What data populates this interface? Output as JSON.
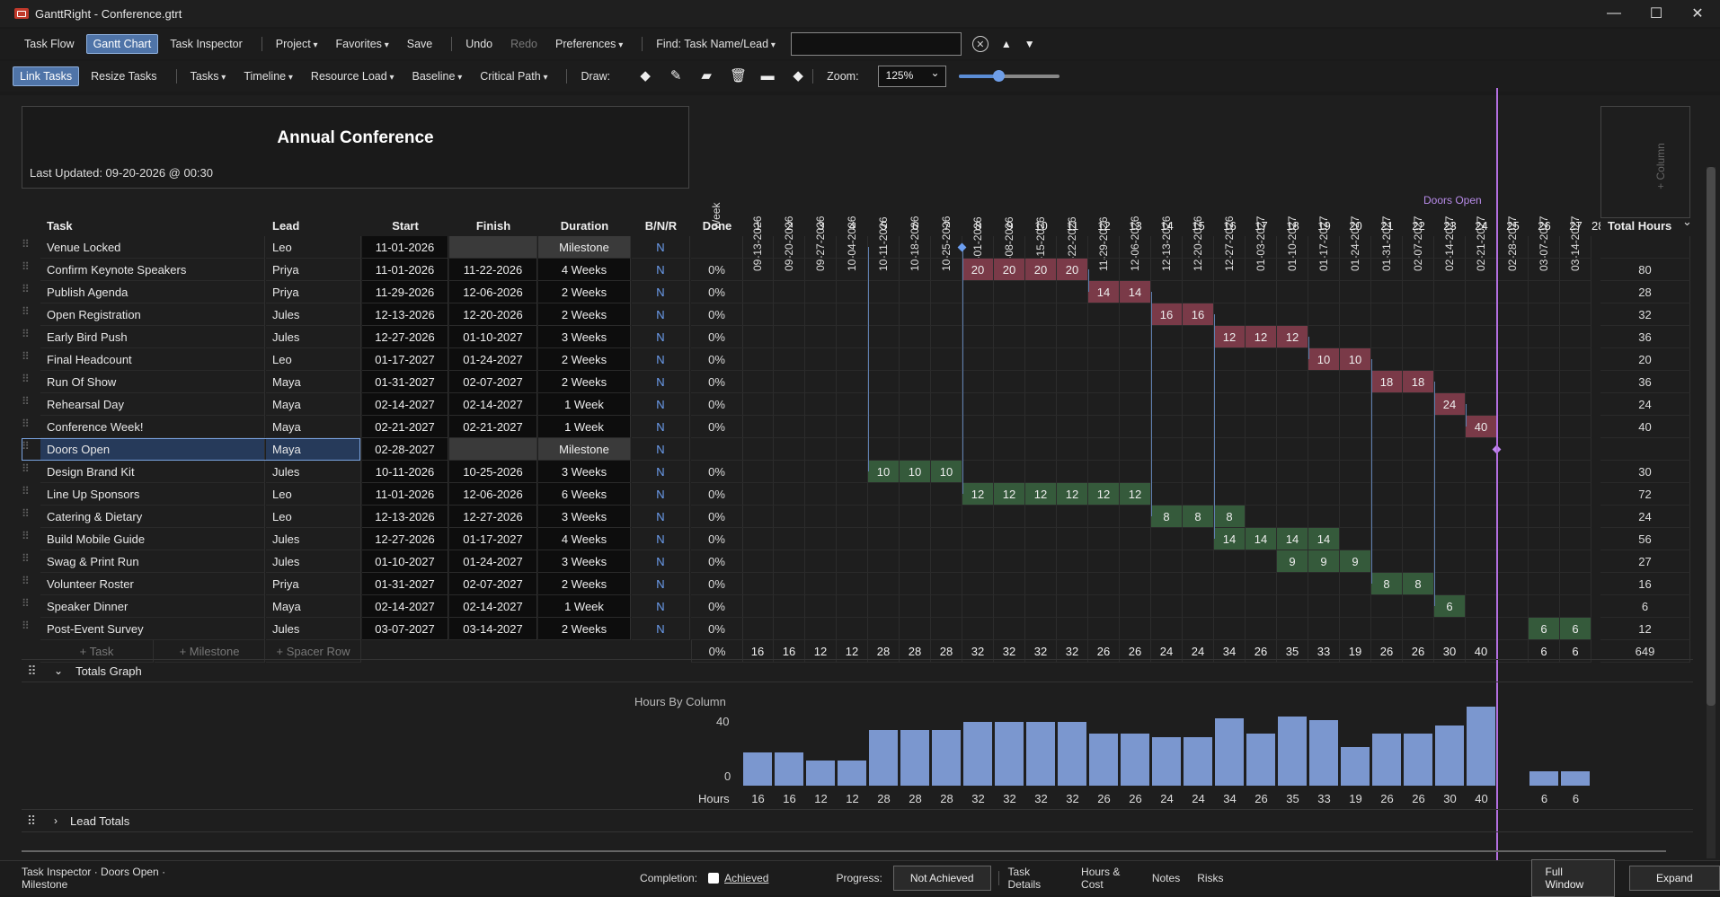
{
  "window": {
    "title": "GanttRight - Conference.gtrt",
    "minimize": "—",
    "maximize": "☐",
    "close": "✕"
  },
  "toolbar1": {
    "task_flow": "Task Flow",
    "gantt_chart": "Gantt Chart",
    "task_inspector": "Task Inspector",
    "project": "Project",
    "favorites": "Favorites",
    "save": "Save",
    "undo": "Undo",
    "redo": "Redo",
    "preferences": "Preferences",
    "find_label": "Find: Task Name/Lead",
    "find_value": ""
  },
  "toolbar2": {
    "link_tasks": "Link Tasks",
    "resize_tasks": "Resize Tasks",
    "tasks": "Tasks",
    "timeline": "Timeline",
    "resource_load": "Resource Load",
    "baseline": "Baseline",
    "critical_path": "Critical Path",
    "draw_label": "Draw:",
    "zoom_label": "Zoom:",
    "zoom_value": "125%",
    "zoom_slider": 0.4
  },
  "project": {
    "title": "Annual Conference",
    "last_updated": "Last Updated: 09-20-2026 @ 00:30"
  },
  "timeline": {
    "week_label": "Week",
    "dates": [
      "09-13-2026",
      "09-20-2026",
      "09-27-2026",
      "10-04-2026",
      "10-11-2026",
      "10-18-2026",
      "10-25-2026",
      "11-01-2026",
      "11-08-2026",
      "11-15-2026",
      "11-22-2026",
      "11-29-2026",
      "12-06-2026",
      "12-13-2026",
      "12-20-2026",
      "12-27-2026",
      "01-03-2027",
      "01-10-2027",
      "01-17-2027",
      "01-24-2027",
      "01-31-2027",
      "02-07-2027",
      "02-14-2027",
      "02-21-2027",
      "02-28-2027",
      "03-07-2027",
      "03-14-2027"
    ],
    "weeks": [
      "1",
      "2",
      "3",
      "4",
      "5",
      "6",
      "7",
      "8",
      "9",
      "10",
      "11",
      "12",
      "13",
      "14",
      "15",
      "16",
      "17",
      "18",
      "19",
      "20",
      "21",
      "22",
      "23",
      "24",
      "25",
      "26",
      "27",
      "28"
    ],
    "add_column": "+ Column",
    "doors_open_marker": "Doors Open"
  },
  "columns": {
    "task": "Task",
    "lead": "Lead",
    "start": "Start",
    "finish": "Finish",
    "duration": "Duration",
    "bnr": "B/N/R",
    "done": "Done",
    "total": "Total Hours"
  },
  "tasks": [
    {
      "name": "Venue Locked",
      "lead": "Leo",
      "start": "11-01-2026",
      "finish": "",
      "duration": "Milestone",
      "bnr": "N",
      "done": "",
      "total": "",
      "color": "ms",
      "weeks": {}
    },
    {
      "name": "Confirm Keynote Speakers",
      "lead": "Priya",
      "start": "11-01-2026",
      "finish": "11-22-2026",
      "duration": "4 Weeks",
      "bnr": "N",
      "done": "0%",
      "total": "80",
      "color": "red",
      "weeks": {
        "8": "20",
        "9": "20",
        "10": "20",
        "11": "20"
      }
    },
    {
      "name": "Publish Agenda",
      "lead": "Priya",
      "start": "11-29-2026",
      "finish": "12-06-2026",
      "duration": "2 Weeks",
      "bnr": "N",
      "done": "0%",
      "total": "28",
      "color": "red",
      "weeks": {
        "12": "14",
        "13": "14"
      }
    },
    {
      "name": "Open Registration",
      "lead": "Jules",
      "start": "12-13-2026",
      "finish": "12-20-2026",
      "duration": "2 Weeks",
      "bnr": "N",
      "done": "0%",
      "total": "32",
      "color": "red",
      "weeks": {
        "14": "16",
        "15": "16"
      }
    },
    {
      "name": "Early Bird Push",
      "lead": "Jules",
      "start": "12-27-2026",
      "finish": "01-10-2027",
      "duration": "3 Weeks",
      "bnr": "N",
      "done": "0%",
      "total": "36",
      "color": "red",
      "weeks": {
        "16": "12",
        "17": "12",
        "18": "12"
      }
    },
    {
      "name": "Final Headcount",
      "lead": "Leo",
      "start": "01-17-2027",
      "finish": "01-24-2027",
      "duration": "2 Weeks",
      "bnr": "N",
      "done": "0%",
      "total": "20",
      "color": "red",
      "weeks": {
        "19": "10",
        "20": "10"
      }
    },
    {
      "name": "Run Of Show",
      "lead": "Maya",
      "start": "01-31-2027",
      "finish": "02-07-2027",
      "duration": "2 Weeks",
      "bnr": "N",
      "done": "0%",
      "total": "36",
      "color": "red",
      "weeks": {
        "21": "18",
        "22": "18"
      }
    },
    {
      "name": "Rehearsal Day",
      "lead": "Maya",
      "start": "02-14-2027",
      "finish": "02-14-2027",
      "duration": "1 Week",
      "bnr": "N",
      "done": "0%",
      "total": "24",
      "color": "red",
      "weeks": {
        "23": "24"
      }
    },
    {
      "name": "Conference Week!",
      "lead": "Maya",
      "start": "02-21-2027",
      "finish": "02-21-2027",
      "duration": "1 Week",
      "bnr": "N",
      "done": "0%",
      "total": "40",
      "color": "red",
      "weeks": {
        "24": "40"
      }
    },
    {
      "name": "Doors Open",
      "lead": "Maya",
      "start": "02-28-2027",
      "finish": "",
      "duration": "Milestone",
      "bnr": "N",
      "done": "",
      "total": "",
      "color": "ms",
      "weeks": {}
    },
    {
      "name": "Design Brand Kit",
      "lead": "Jules",
      "start": "10-11-2026",
      "finish": "10-25-2026",
      "duration": "3 Weeks",
      "bnr": "N",
      "done": "0%",
      "total": "30",
      "color": "grn",
      "weeks": {
        "5": "10",
        "6": "10",
        "7": "10"
      }
    },
    {
      "name": "Line Up Sponsors",
      "lead": "Leo",
      "start": "11-01-2026",
      "finish": "12-06-2026",
      "duration": "6 Weeks",
      "bnr": "N",
      "done": "0%",
      "total": "72",
      "color": "grn",
      "weeks": {
        "8": "12",
        "9": "12",
        "10": "12",
        "11": "12",
        "12": "12",
        "13": "12"
      }
    },
    {
      "name": "Catering & Dietary",
      "lead": "Leo",
      "start": "12-13-2026",
      "finish": "12-27-2026",
      "duration": "3 Weeks",
      "bnr": "N",
      "done": "0%",
      "total": "24",
      "color": "grn",
      "weeks": {
        "14": "8",
        "15": "8",
        "16": "8"
      }
    },
    {
      "name": "Build Mobile Guide",
      "lead": "Jules",
      "start": "12-27-2026",
      "finish": "01-17-2027",
      "duration": "4 Weeks",
      "bnr": "N",
      "done": "0%",
      "total": "56",
      "color": "grn",
      "weeks": {
        "16": "14",
        "17": "14",
        "18": "14",
        "19": "14"
      }
    },
    {
      "name": "Swag & Print Run",
      "lead": "Jules",
      "start": "01-10-2027",
      "finish": "01-24-2027",
      "duration": "3 Weeks",
      "bnr": "N",
      "done": "0%",
      "total": "27",
      "color": "grn",
      "weeks": {
        "18": "9",
        "19": "9",
        "20": "9"
      }
    },
    {
      "name": "Volunteer Roster",
      "lead": "Priya",
      "start": "01-31-2027",
      "finish": "02-07-2027",
      "duration": "2 Weeks",
      "bnr": "N",
      "done": "0%",
      "total": "16",
      "color": "grn",
      "weeks": {
        "21": "8",
        "22": "8"
      }
    },
    {
      "name": "Speaker Dinner",
      "lead": "Maya",
      "start": "02-14-2027",
      "finish": "02-14-2027",
      "duration": "1 Week",
      "bnr": "N",
      "done": "0%",
      "total": "6",
      "color": "grn",
      "weeks": {
        "23": "6"
      }
    },
    {
      "name": "Post-Event Survey",
      "lead": "Jules",
      "start": "03-07-2027",
      "finish": "03-14-2027",
      "duration": "2 Weeks",
      "bnr": "N",
      "done": "0%",
      "total": "12",
      "color": "grn",
      "weeks": {
        "26": "6",
        "27": "6"
      }
    }
  ],
  "add_row": {
    "task": "+ Task",
    "milestone": "+ Milestone",
    "spacer": "+ Spacer Row"
  },
  "totals": {
    "done": "0%",
    "weeks": [
      "16",
      "16",
      "12",
      "12",
      "28",
      "28",
      "28",
      "32",
      "32",
      "32",
      "32",
      "26",
      "26",
      "24",
      "24",
      "34",
      "26",
      "35",
      "33",
      "19",
      "26",
      "26",
      "30",
      "40",
      "",
      "6",
      "6"
    ],
    "grand_total": "649"
  },
  "totals_graph": {
    "label": "Totals Graph",
    "title": "Hours By Column",
    "y_max_label": "40",
    "y_min_label": "0",
    "row_label": "Hours"
  },
  "chart_data": {
    "type": "bar",
    "title": "Hours By Column",
    "categories": [
      "1",
      "2",
      "3",
      "4",
      "5",
      "6",
      "7",
      "8",
      "9",
      "10",
      "11",
      "12",
      "13",
      "14",
      "15",
      "16",
      "17",
      "18",
      "19",
      "20",
      "21",
      "22",
      "23",
      "24",
      "25",
      "26",
      "27"
    ],
    "values": [
      16,
      16,
      12,
      12,
      28,
      28,
      28,
      32,
      32,
      32,
      32,
      26,
      26,
      24,
      24,
      34,
      26,
      35,
      33,
      19,
      26,
      26,
      30,
      40,
      0,
      6,
      6
    ],
    "ylim": [
      0,
      40
    ],
    "xlabel": "",
    "ylabel": ""
  },
  "lead_totals": {
    "label": "Lead Totals"
  },
  "footer": {
    "inspector": "Task Inspector · Doors Open · Milestone",
    "completion_label": "Completion:",
    "achieved": "Achieved",
    "progress_label": "Progress:",
    "progress_value": "Not Achieved",
    "task_details": "Task Details",
    "hours_cost": "Hours & Cost",
    "notes": "Notes",
    "risks": "Risks",
    "full_window": "Full Window",
    "expand": "Expand"
  },
  "colors": {
    "accent": "#4f74a8",
    "red_bar": "#7a3a48",
    "green_bar": "#355a3b",
    "doors_line": "#b36fe0",
    "graph_bar": "#7b97cf"
  }
}
